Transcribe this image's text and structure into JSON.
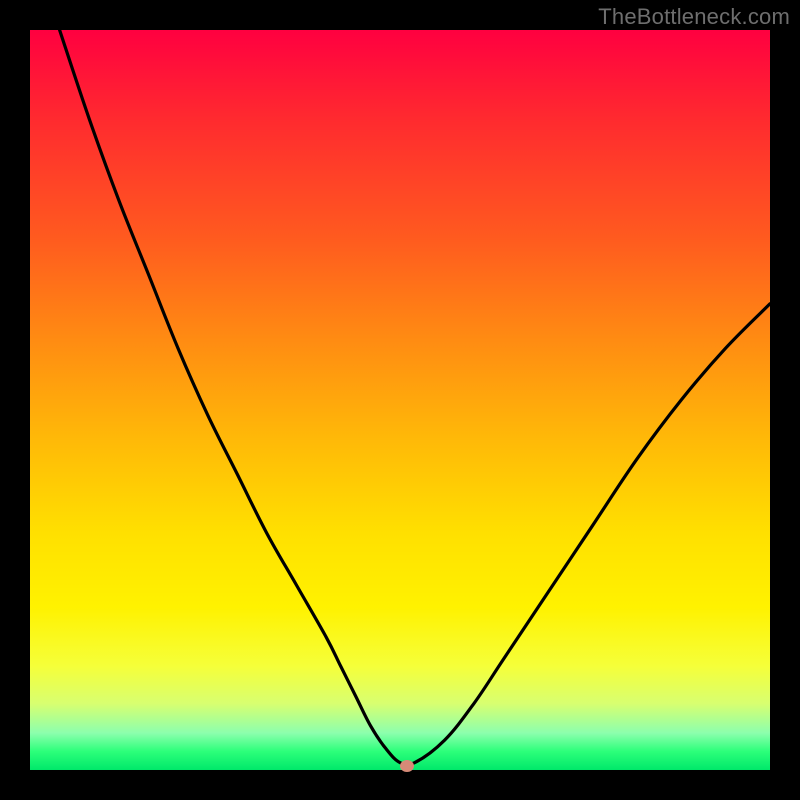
{
  "watermark": "TheBottleneck.com",
  "colors": {
    "frame": "#000000",
    "gradient_top": "#ff0040",
    "gradient_mid": "#ffe000",
    "gradient_bottom": "#00e86a",
    "curve": "#000000",
    "marker": "#d68a77"
  },
  "chart_data": {
    "type": "line",
    "title": "",
    "xlabel": "",
    "ylabel": "",
    "xlim": [
      0,
      100
    ],
    "ylim": [
      0,
      100
    ],
    "grid": false,
    "legend": false,
    "series": [
      {
        "name": "bottleneck-curve",
        "x": [
          4,
          8,
          12,
          16,
          20,
          24,
          28,
          32,
          36,
          40,
          42,
          44,
          46,
          48,
          50,
          52,
          56,
          60,
          64,
          70,
          76,
          82,
          88,
          94,
          100
        ],
        "values": [
          100,
          88,
          77,
          67,
          57,
          48,
          40,
          32,
          25,
          18,
          14,
          10,
          6,
          3,
          1,
          1,
          4,
          9,
          15,
          24,
          33,
          42,
          50,
          57,
          63
        ]
      }
    ],
    "annotations": [
      {
        "name": "optimal-point",
        "x": 51,
        "y": 0.5
      }
    ],
    "background_gradient": {
      "type": "vertical",
      "stops": [
        {
          "pos": 0.0,
          "color": "#ff0040"
        },
        {
          "pos": 0.55,
          "color": "#ffb808"
        },
        {
          "pos": 0.78,
          "color": "#fff200"
        },
        {
          "pos": 0.97,
          "color": "#2cff7a"
        },
        {
          "pos": 1.0,
          "color": "#00e86a"
        }
      ]
    }
  }
}
